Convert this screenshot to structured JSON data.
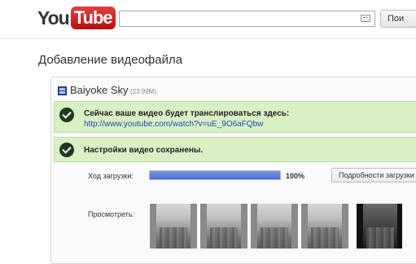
{
  "header": {
    "logo_you": "You",
    "logo_tube": "Tube",
    "search_value": "",
    "search_button": "Пои"
  },
  "page_title": "Добавление видеофайла",
  "upload": {
    "file_name": "Baiyoke Sky",
    "file_size": "(23.99M)",
    "broadcast_message": "Сейчас ваше видео будет транслироваться здесь:",
    "video_url": "http://www.youtube.com/watch?v=uE_9O6aFQbw",
    "settings_saved_message": "Настройки видео сохранены.",
    "progress_label": "Ход загрузки:",
    "progress_percent": "100%",
    "progress_fraction": 1.0,
    "details_button": "Подробности загрузки",
    "preview_label": "Просмотреть:",
    "thumbnails": 5
  },
  "colors": {
    "success_bg": "#d9f0c5",
    "progress": "#4a6ccf",
    "link": "#1a4bb0",
    "logo_red": "#cc2020"
  }
}
